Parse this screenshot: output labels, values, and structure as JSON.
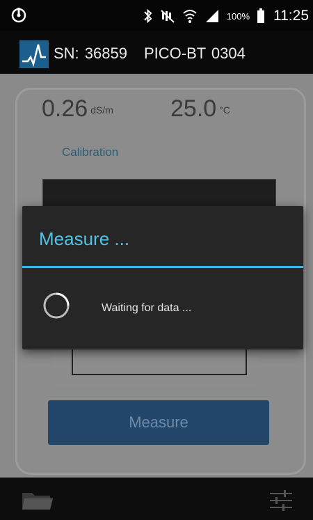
{
  "status_bar": {
    "left_icon": "sync-circle-icon",
    "icons": [
      "bluetooth-icon",
      "mute-icon",
      "wifi-icon",
      "signal-icon",
      "battery-icon"
    ],
    "battery_percent": "100%",
    "time": "11:25"
  },
  "action_bar": {
    "logo_icon": "pulse-logo-icon",
    "serial": "SN: 36859",
    "device_name": "PICO-BT 0304"
  },
  "readings": {
    "ec_value": "0.26",
    "ec_unit": "dS/m",
    "temp_value": "25.0",
    "temp_unit": "°C"
  },
  "calibration_label": "Calibration",
  "measure_button_label": "Measure",
  "dialog": {
    "title": "Measure ...",
    "message": "Waiting for data ..."
  },
  "bottom_bar": {
    "left_icon": "folder-icon",
    "right_icon": "sliders-icon"
  },
  "colors": {
    "accent": "#3cb9df",
    "button": "#23476a",
    "dialog_bg": "#262626"
  }
}
